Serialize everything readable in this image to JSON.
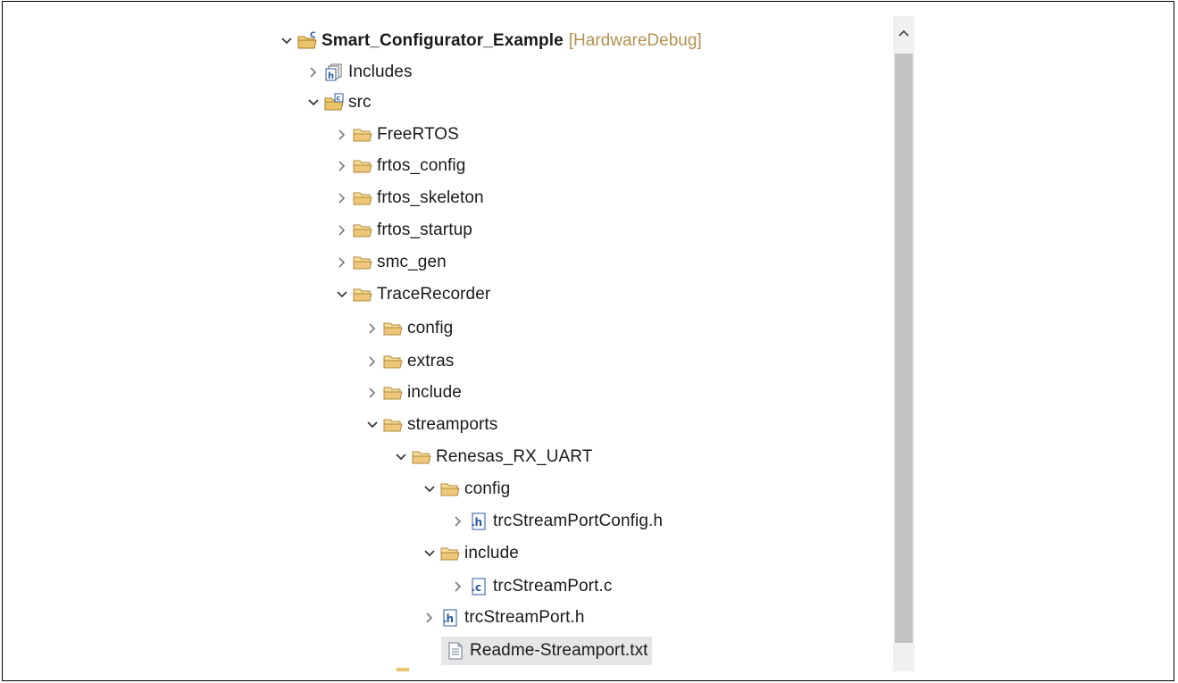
{
  "tree": {
    "project": {
      "name": "Smart_Configurator_Example",
      "decoration": "[HardwareDebug]"
    },
    "items": [
      {
        "label": "Includes"
      },
      {
        "label": "src"
      },
      {
        "label": "FreeRTOS"
      },
      {
        "label": "frtos_config"
      },
      {
        "label": "frtos_skeleton"
      },
      {
        "label": "frtos_startup"
      },
      {
        "label": "smc_gen"
      },
      {
        "label": "TraceRecorder"
      },
      {
        "label": "config"
      },
      {
        "label": "extras"
      },
      {
        "label": "include"
      },
      {
        "label": "streamports"
      },
      {
        "label": "Renesas_RX_UART"
      },
      {
        "label": "config"
      },
      {
        "label": "trcStreamPortConfig.h"
      },
      {
        "label": "include"
      },
      {
        "label": "trcStreamPort.c"
      },
      {
        "label": "trcStreamPort.h"
      },
      {
        "label": "Readme-Streamport.txt"
      }
    ]
  },
  "colors": {
    "folder": "#e9c46a",
    "decoration": "#b5904f",
    "selection": "#e6e6e6",
    "scroll_thumb": "#c2c2c2"
  },
  "icons": {
    "project": "c-project-icon",
    "includes": "includes-icon",
    "source_folder": "source-folder-icon",
    "folder": "folder-icon",
    "header_file": "h-file-icon",
    "c_file": "c-file-icon",
    "text_file": "text-file-icon"
  }
}
